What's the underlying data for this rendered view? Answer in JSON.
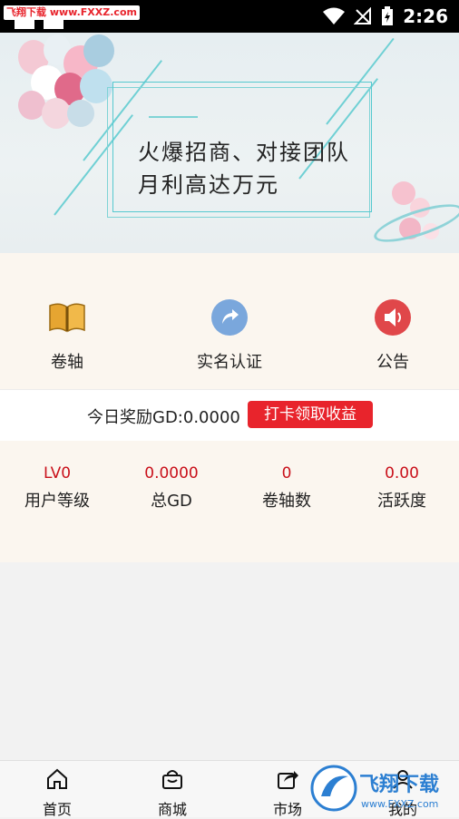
{
  "status_bar": {
    "watermark": "飞翔下载 www.FXXZ.com",
    "time": "2:26"
  },
  "banner": {
    "line1": "火爆招商、对接团队",
    "line2": "月利高达万元"
  },
  "menu": {
    "items": [
      {
        "label": "卷轴",
        "icon": "book-icon"
      },
      {
        "label": "实名认证",
        "icon": "share-arrow-icon"
      },
      {
        "label": "公告",
        "icon": "speaker-icon"
      }
    ]
  },
  "reward": {
    "text": "今日奖励GD:0.0000",
    "button": "打卡领取收益"
  },
  "stats": [
    {
      "value": "LV0",
      "label": "用户等级"
    },
    {
      "value": "0.0000",
      "label": "总GD"
    },
    {
      "value": "0",
      "label": "卷轴数"
    },
    {
      "value": "0.00",
      "label": "活跃度"
    }
  ],
  "bottom_nav": [
    {
      "label": "首页",
      "icon": "home-icon"
    },
    {
      "label": "商城",
      "icon": "shopping-bag-icon"
    },
    {
      "label": "市场",
      "icon": "market-share-icon"
    },
    {
      "label": "我的",
      "icon": "user-icon"
    }
  ],
  "colors": {
    "accent_red": "#e8242c",
    "value_red": "#c9111b",
    "cream_bg": "#fbf6ef",
    "icon_blue": "#7aa7dc"
  },
  "watermark_logo": {
    "brand": "飞翔下载",
    "url": "www.FXXZ.com"
  }
}
